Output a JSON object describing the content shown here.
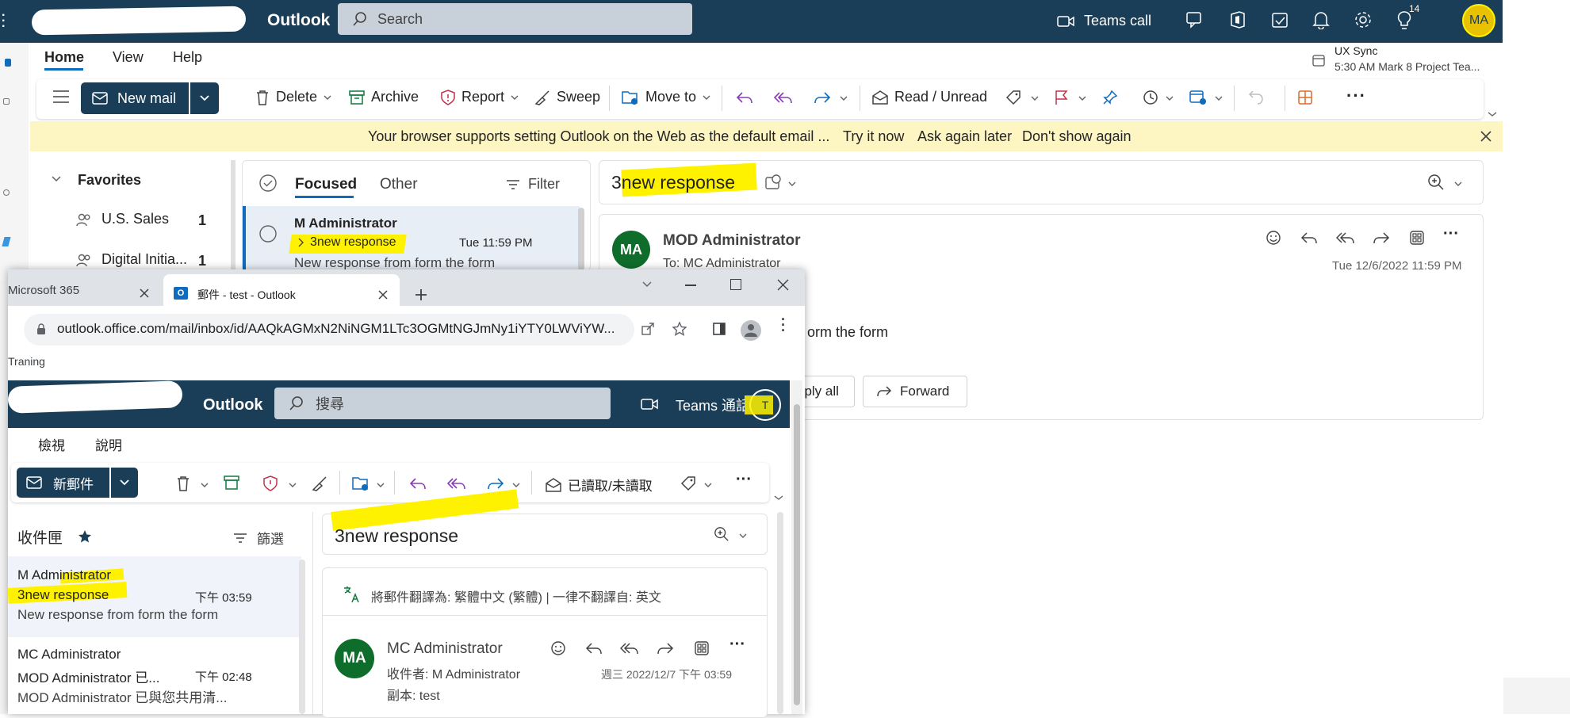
{
  "back": {
    "brand": "Outlook",
    "search_placeholder": "Search",
    "teams_call": "Teams call",
    "notif_count": "14",
    "user_initials": "MA",
    "tabs": [
      "Home",
      "View",
      "Help"
    ],
    "reminder": {
      "title": "UX Sync",
      "detail": "5:30 AM Mark 8 Project Tea..."
    },
    "toolbar": {
      "new_mail": "New mail",
      "delete": "Delete",
      "archive": "Archive",
      "report": "Report",
      "sweep": "Sweep",
      "move_to": "Move to",
      "read_unread": "Read / Unread"
    },
    "banner": {
      "text": "Your browser supports setting Outlook on the Web as the default email ...",
      "try_it": "Try it now",
      "ask_later": "Ask again later",
      "dont_show": "Don't show again"
    },
    "favorites": {
      "title": "Favorites",
      "items": [
        {
          "label": "U.S. Sales",
          "count": "1"
        },
        {
          "label": "Digital Initia...",
          "count": "1"
        }
      ]
    },
    "list": {
      "tab_focused": "Focused",
      "tab_other": "Other",
      "filter": "Filter",
      "message": {
        "sender": "M      Administrator",
        "subject": "3new response",
        "time": "Tue 11:59 PM",
        "preview": "New response from form the form"
      }
    },
    "reading": {
      "subject": "3new response",
      "avatar": "MA",
      "from": "MOD Administrator",
      "to_label": "To:",
      "to": "MC      Administrator",
      "date": "Tue 12/6/2022 11:59 PM",
      "body_fragment": "orm the form",
      "reply_all_fragment": "eply all",
      "forward": "Forward"
    }
  },
  "chrome": {
    "tab1": "Microsoft 365",
    "tab2": "郵件 - test - Outlook",
    "url": "outlook.office.com/mail/inbox/id/AAQkAGMxN2NiNGM1LTc3OGMtNGJmNy1iYTY0LWViYW...",
    "bookmark": "Traning"
  },
  "front": {
    "brand": "Outlook",
    "search_placeholder": "搜尋",
    "teams": "Teams 通話",
    "avatar": "T",
    "tabs": [
      "檢視",
      "說明"
    ],
    "new_mail": "新郵件",
    "read_unread": "已讀取/未讀取",
    "inbox": "收件匣",
    "filter": "篩選",
    "messages": [
      {
        "sender": "M      Administrator",
        "subject": "3new response",
        "time": "下午 03:59",
        "preview": "New response from form the form"
      },
      {
        "sender": "MC      Administrator",
        "subject": "MOD Administrator 已...",
        "time": "下午 02:48",
        "preview": "MOD Administrator 已與您共用清..."
      }
    ],
    "reading": {
      "subject": "3new response",
      "translate": "將郵件翻譯為: 繁體中文 (繁體) | 一律不翻譯自: 英文",
      "avatar": "MA",
      "from": "MC      Administrator",
      "to": "收件者:  M      Administrator",
      "cc": "副本:  test",
      "date": "週三 2022/12/7 下午 03:59"
    }
  },
  "colors": {
    "header": "#1b3e58",
    "accent": "#0f6cbd",
    "highlight": "#fff200",
    "banner": "#fdf6c3",
    "avatar_green": "#0f6d2c"
  }
}
